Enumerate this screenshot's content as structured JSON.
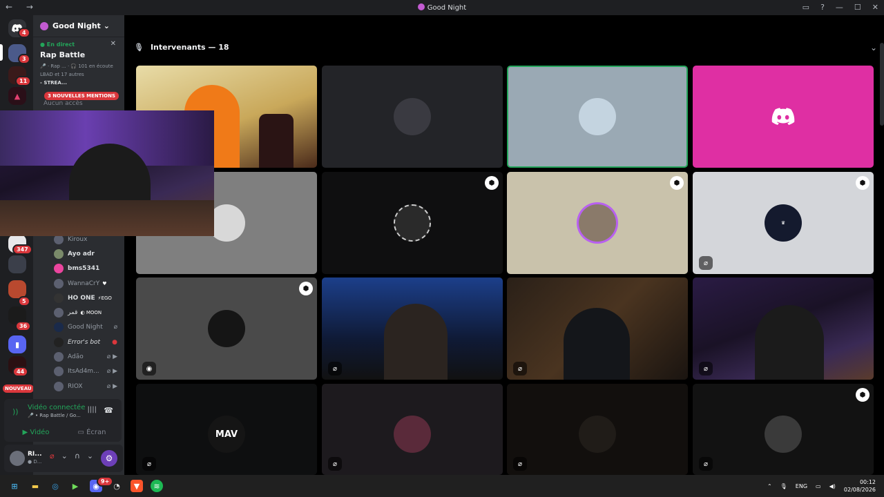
{
  "window": {
    "title": "Good Night",
    "nav": "← →",
    "controls": [
      "▭",
      "?",
      "—",
      "☐",
      "✕"
    ]
  },
  "server": {
    "name": "Good Night",
    "invite_icon": "add-user-icon"
  },
  "live": {
    "tag": "● En direct",
    "channel": "Rap Battle",
    "line1": "🎤 · Rap ...  ·  🎧 101 en écoute",
    "line2": "LBAD et 17 autres",
    "line3": "- STREA...",
    "mention_banner": "3 NOUVELLES MENTIONS",
    "no_access": "Aucun accès"
  },
  "rail": [
    {
      "name": "discord-home",
      "badge": "4"
    },
    {
      "name": "server-1",
      "badge": "3"
    },
    {
      "name": "server-2",
      "badge": "11"
    },
    {
      "name": "server-3",
      "badge": ""
    },
    {
      "name": "server-4",
      "badge": "347"
    },
    {
      "name": "server-5",
      "badge": "5"
    },
    {
      "name": "server-6",
      "badge": "36"
    },
    {
      "name": "server-7",
      "badge": ""
    },
    {
      "name": "server-8",
      "badge": "44"
    }
  ],
  "rail_new": "NOUVEAU",
  "members": [
    {
      "name": "Kiroux",
      "tag": "",
      "dim": true
    },
    {
      "name": "Ayo adr",
      "tag": "",
      "dim": false
    },
    {
      "name": "bms5341",
      "tag": "",
      "dim": false
    },
    {
      "name": "WannaCrY",
      "tag": "♥",
      "dim": true
    },
    {
      "name": "HO ONE",
      "tag": "⚡EGO",
      "dim": false
    },
    {
      "name": "قمر",
      "tag": "◐ MOON",
      "dim": false
    },
    {
      "name": "Good Night",
      "tag": "",
      "dim": true
    },
    {
      "name": "Error's bot",
      "tag": "",
      "dim": false
    },
    {
      "name": "Adão",
      "tag": "",
      "dim": true
    },
    {
      "name": "ItsAd4m...",
      "tag": "",
      "dim": true
    },
    {
      "name": "RIOX",
      "tag": "",
      "dim": true
    }
  ],
  "voice": {
    "status": "Vidéo connectée",
    "channel": "🎤 • Rap Battle / Go...",
    "video": "Vidéo",
    "screen": "Écran"
  },
  "user": {
    "name": "RI...",
    "status": "● D..."
  },
  "stage": {
    "header": "Intervenants — 18"
  },
  "taskbar": {
    "lang": "ENG",
    "time": "00:12",
    "date": "02/08/2026",
    "discord_badge": "9+"
  }
}
